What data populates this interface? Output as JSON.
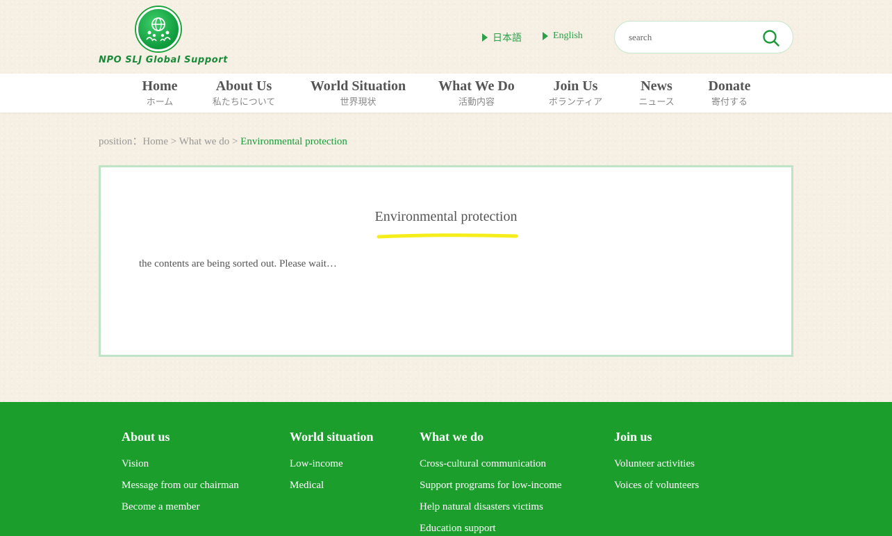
{
  "header": {
    "logo_text": "NPO SLJ Global Support",
    "languages": [
      {
        "label": "日本語"
      },
      {
        "label": "English"
      }
    ],
    "search": {
      "placeholder": "search",
      "icon": "search-icon"
    }
  },
  "nav": {
    "items": [
      {
        "en": "Home",
        "ja": "ホーム"
      },
      {
        "en": "About Us",
        "ja": "私たちについて"
      },
      {
        "en": "World Situation",
        "ja": "世界現状"
      },
      {
        "en": "What We Do",
        "ja": "活動内容"
      },
      {
        "en": "Join Us",
        "ja": "ボランティア"
      },
      {
        "en": "News",
        "ja": "ニュース"
      },
      {
        "en": "Donate",
        "ja": "寄付する"
      }
    ]
  },
  "breadcrumb": {
    "prefix": "position：",
    "home": "Home",
    "sep1": " > ",
    "section": "What we do",
    "sep2": " > ",
    "current": "Environmental protection"
  },
  "content": {
    "title": "Environmental protection",
    "body": "the contents are being sorted out. Please wait…"
  },
  "footer": {
    "columns": [
      {
        "title": "About us",
        "links": [
          "Vision",
          "Message from our chairman",
          "Become a member"
        ]
      },
      {
        "title": "World situation",
        "links": [
          "Low-income",
          "Medical"
        ]
      },
      {
        "title": "What we do",
        "links": [
          "Cross-cultural communication",
          "Support programs for low-income",
          "Help natural disasters victims",
          "Education support"
        ]
      },
      {
        "title": "Join us",
        "links": [
          "Volunteer activities",
          "Voices of volunteers"
        ]
      }
    ]
  },
  "colors": {
    "brand_green": "#1c9e2d",
    "accent_green": "#1a9a3a",
    "highlight_yellow": "#f5ee1a",
    "box_border": "#bfe3c6"
  }
}
